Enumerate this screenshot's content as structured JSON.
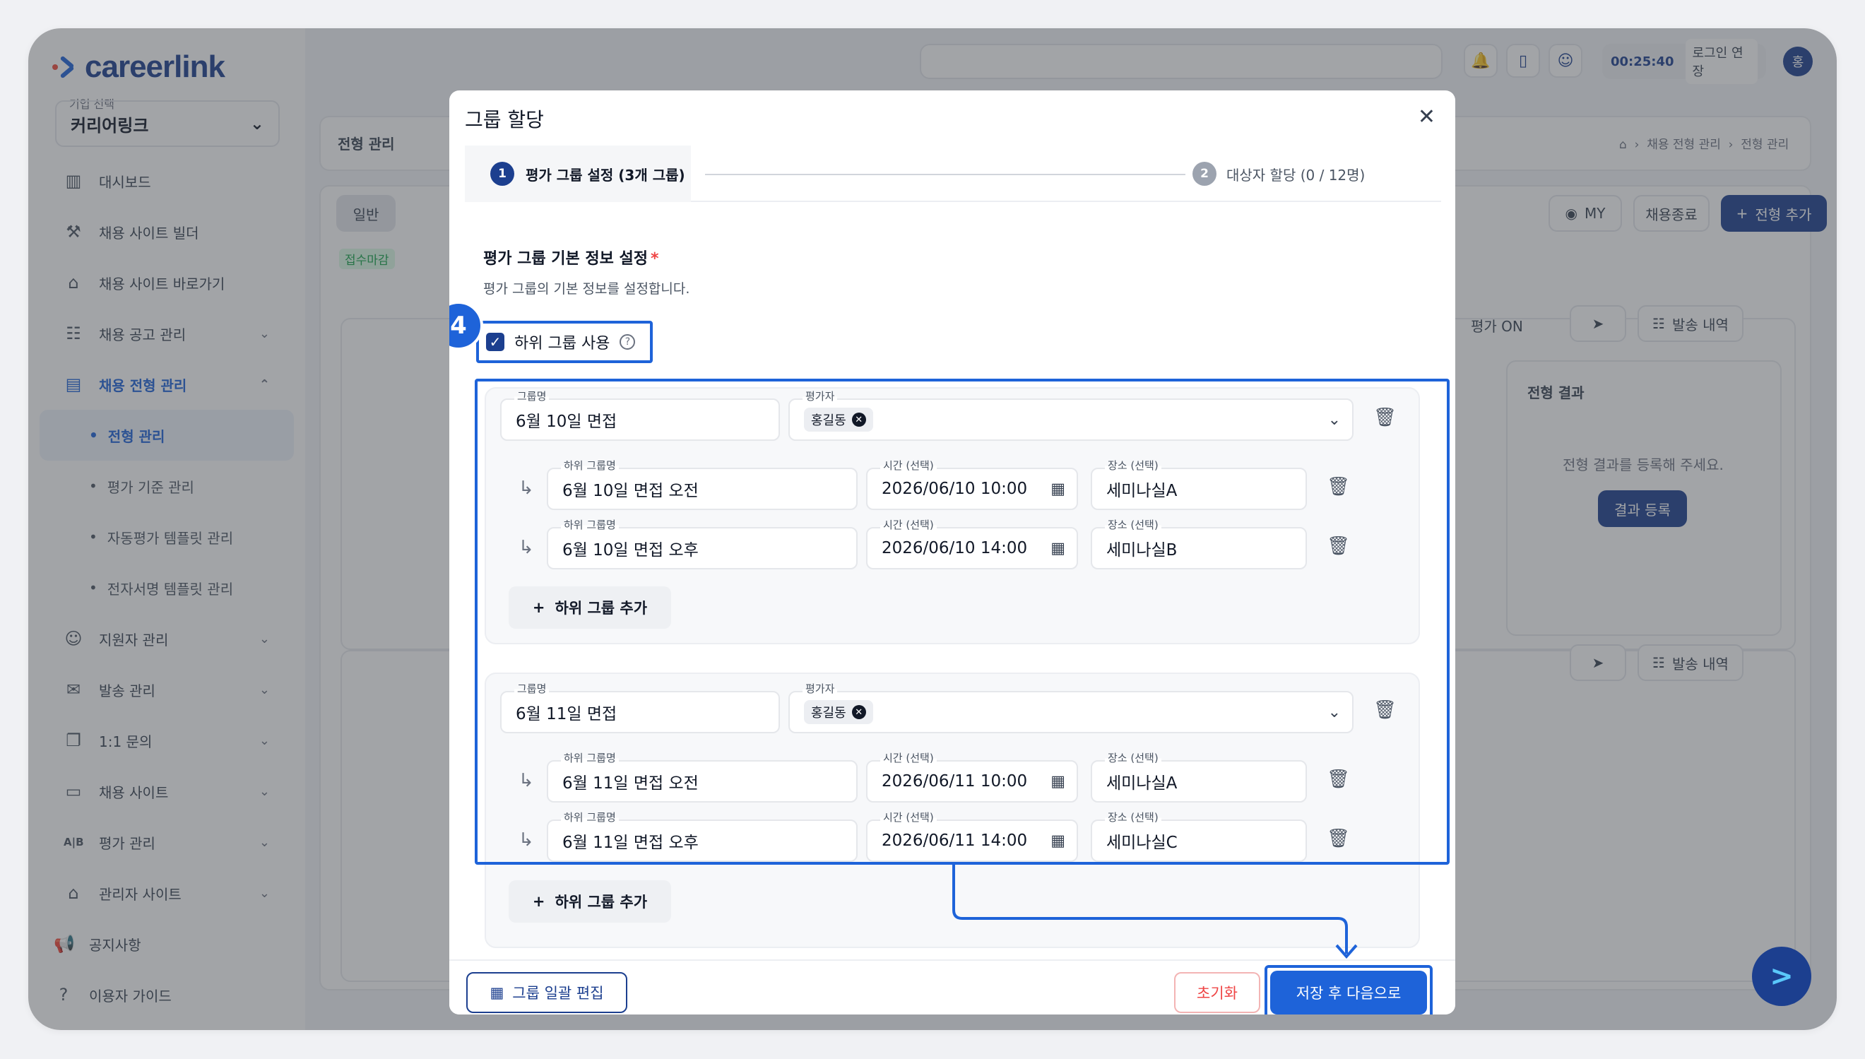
{
  "app": {
    "logo_text": "careerlink",
    "company_label": "기업 선택",
    "company_value": "커리어링크",
    "timer": "00:25:40",
    "login_extend": "로그인 연장",
    "avatar_initial": "홍",
    "colors": {
      "brand": "#1c3f8f",
      "accent": "#1e63d9",
      "danger": "#ef4444"
    }
  },
  "sidebar": {
    "items": [
      {
        "label": "대시보드",
        "icon": "chart-icon"
      },
      {
        "label": "채용 사이트 빌더",
        "icon": "tools-icon"
      },
      {
        "label": "채용 사이트 바로가기",
        "icon": "home-icon"
      },
      {
        "label": "채용 공고 관리",
        "icon": "list-icon"
      },
      {
        "label": "채용 전형 관리",
        "icon": "clipboard-icon"
      },
      {
        "label": "전형 관리"
      },
      {
        "label": "평가 기준 관리"
      },
      {
        "label": "자동평가 템플릿 관리"
      },
      {
        "label": "전자서명 템플릿 관리"
      },
      {
        "label": "지원자 관리",
        "icon": "users-icon"
      },
      {
        "label": "발송 관리",
        "icon": "mail-icon"
      },
      {
        "label": "1:1 문의",
        "icon": "chat-icon"
      },
      {
        "label": "채용 사이트",
        "icon": "window-icon"
      },
      {
        "label": "평가 관리",
        "icon": "ab-icon"
      },
      {
        "label": "관리자 사이트",
        "icon": "admin-icon"
      },
      {
        "label": "공지사항",
        "icon": "megaphone-icon"
      },
      {
        "label": "이용자 가이드",
        "icon": "help-icon"
      }
    ]
  },
  "background": {
    "page_title": "전형 관리",
    "breadcrumb": [
      "채용 전형 관리",
      "전형 관리"
    ],
    "tab_general": "일반",
    "status_badge": "접수마감",
    "my_btn": "MY",
    "close_btn": "채용종료",
    "add_btn": "전형 추가",
    "eval_on": "평가 ON",
    "send_history": "발송 내역",
    "result_title": "전형 결과",
    "result_desc": "전형 결과를 등록해 주세요.",
    "result_btn": "결과 등록"
  },
  "modal": {
    "title": "그룹 할당",
    "step1": {
      "num": "1",
      "label": "평가 그룹 설정 (3개 그룹)"
    },
    "step2": {
      "num": "2",
      "label": "대상자 할당 (0 / 12명)"
    },
    "section_title": "평가 그룹 기본 정보 설정",
    "required_mark": "*",
    "section_desc": "평가 그룹의 기본 정보를 설정합니다.",
    "subgroup_checkbox": "하위 그룹 사용",
    "callout_number": "4",
    "labels": {
      "group_name": "그룹명",
      "evaluator": "평가자",
      "subgroup_name": "하위 그룹명",
      "time": "시간 (선택)",
      "place": "장소 (선택)"
    },
    "add_subgroup": "하위 그룹 추가",
    "groups": [
      {
        "name": "6월 10일 면접",
        "evaluator": "홍길동",
        "subgroups": [
          {
            "name": "6월 10일 면접 오전",
            "time": "2026/06/10 10:00",
            "place": "세미나실A"
          },
          {
            "name": "6월 10일 면접 오후",
            "time": "2026/06/10 14:00",
            "place": "세미나실B"
          }
        ]
      },
      {
        "name": "6월 11일 면접",
        "evaluator": "홍길동",
        "subgroups": [
          {
            "name": "6월 11일 면접 오전",
            "time": "2026/06/11 10:00",
            "place": "세미나실A"
          },
          {
            "name": "6월 11일 면접 오후",
            "time": "2026/06/11 14:00",
            "place": "세미나실C"
          }
        ]
      }
    ],
    "footer": {
      "bulk_edit": "그룹 일괄 편집",
      "reset": "초기화",
      "save_next": "저장 후 다음으로"
    }
  }
}
